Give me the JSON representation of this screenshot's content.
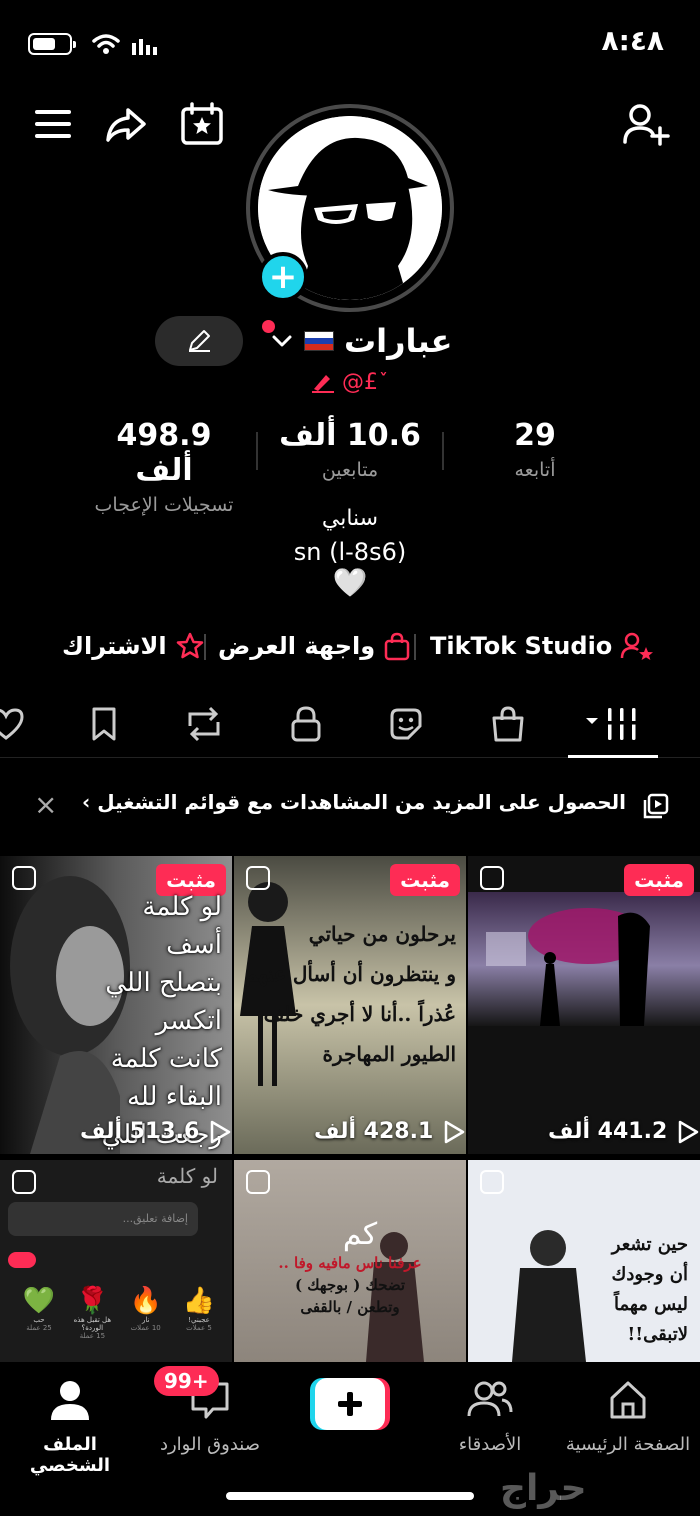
{
  "status": {
    "time": "٨:٤٨"
  },
  "profile": {
    "name": "عبارات",
    "handle": "@£ ٚ",
    "stats": {
      "likes": {
        "value": "498.9 ألف",
        "label": "تسجيلات الإعجاب"
      },
      "followers": {
        "value": "10.6 ألف",
        "label": "متابعين"
      },
      "following": {
        "value": "29",
        "label": "أتابعه"
      }
    },
    "bio_line1": "سنابي",
    "bio_line2": "sn (l-8s6)",
    "bio_heart": "🤍"
  },
  "links": {
    "studio": "TikTok Studio",
    "showcase": "واجهة العرض",
    "subscribe": "الاشتراك"
  },
  "banner": {
    "text": "الحصول على المزيد من المشاهدات مع قوائم التشغيل ›",
    "close": "×"
  },
  "videos": [
    {
      "pinned": "مثبت",
      "views": "441.2 ألف"
    },
    {
      "pinned": "مثبت",
      "views": "428.1 ألف",
      "lines": [
        "يرحلون من حياتي",
        "و ينتظرون أن أسأل عنهم",
        "عُذراً ..أنا لا أجري خلف",
        "الطيور المهاجرة"
      ]
    },
    {
      "pinned": "مثبت",
      "views": "513.6 ألف",
      "lines": [
        "لو كلمة",
        "أسف",
        "بتصلح اللي",
        "اتكسر",
        "كانت كلمة",
        "البقاء لله",
        "رجعت اللي"
      ]
    },
    {
      "lines": [
        "حين تشعر",
        "أن وجودك",
        "ليس مهماً",
        "لاتبقى!!"
      ]
    },
    {
      "lines": [
        "كم",
        "عرفنا ناس مافيه وفا ..",
        "تضحك ( بوجهك )",
        "وتطعن / بالقفى"
      ]
    },
    {
      "title": "لو كلمة",
      "comment_placeholder": "إضافة تعليق...",
      "gifts": [
        {
          "name": "عجبني!",
          "price": "5 عملات"
        },
        {
          "name": "نار",
          "price": "10 عملات"
        },
        {
          "name": "هل تقبل هذه الوردة؟",
          "price": "15 عملة"
        },
        {
          "name": "حب",
          "price": "25 عملة"
        }
      ]
    }
  ],
  "nav": {
    "home": "الصفحة الرئيسية",
    "friends": "الأصدقاء",
    "inbox": "صندوق الوارد",
    "inbox_badge": "99+",
    "profile": "الملف الشخصي"
  },
  "watermark": "حراج",
  "colors": {
    "accent": "#fe2c55",
    "teal": "#20d5ec",
    "background": "#000000"
  }
}
